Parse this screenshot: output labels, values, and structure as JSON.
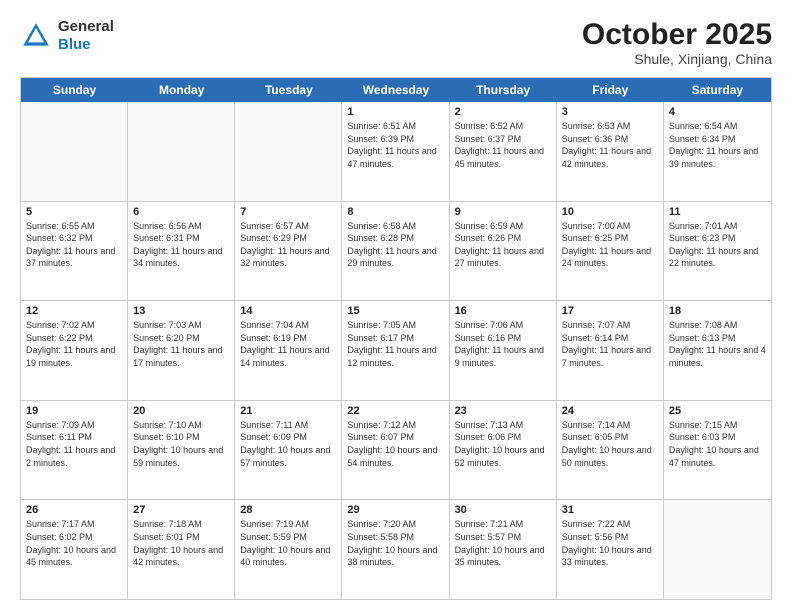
{
  "header": {
    "logo_general": "General",
    "logo_blue": "Blue",
    "title": "October 2025",
    "subtitle": "Shule, Xinjiang, China"
  },
  "weekdays": [
    "Sunday",
    "Monday",
    "Tuesday",
    "Wednesday",
    "Thursday",
    "Friday",
    "Saturday"
  ],
  "rows": [
    [
      {
        "day": "",
        "text": ""
      },
      {
        "day": "",
        "text": ""
      },
      {
        "day": "",
        "text": ""
      },
      {
        "day": "1",
        "text": "Sunrise: 6:51 AM\nSunset: 6:39 PM\nDaylight: 11 hours and 47 minutes."
      },
      {
        "day": "2",
        "text": "Sunrise: 6:52 AM\nSunset: 6:37 PM\nDaylight: 11 hours and 45 minutes."
      },
      {
        "day": "3",
        "text": "Sunrise: 6:53 AM\nSunset: 6:36 PM\nDaylight: 11 hours and 42 minutes."
      },
      {
        "day": "4",
        "text": "Sunrise: 6:54 AM\nSunset: 6:34 PM\nDaylight: 11 hours and 39 minutes."
      }
    ],
    [
      {
        "day": "5",
        "text": "Sunrise: 6:55 AM\nSunset: 6:32 PM\nDaylight: 11 hours and 37 minutes."
      },
      {
        "day": "6",
        "text": "Sunrise: 6:56 AM\nSunset: 6:31 PM\nDaylight: 11 hours and 34 minutes."
      },
      {
        "day": "7",
        "text": "Sunrise: 6:57 AM\nSunset: 6:29 PM\nDaylight: 11 hours and 32 minutes."
      },
      {
        "day": "8",
        "text": "Sunrise: 6:58 AM\nSunset: 6:28 PM\nDaylight: 11 hours and 29 minutes."
      },
      {
        "day": "9",
        "text": "Sunrise: 6:59 AM\nSunset: 6:26 PM\nDaylight: 11 hours and 27 minutes."
      },
      {
        "day": "10",
        "text": "Sunrise: 7:00 AM\nSunset: 6:25 PM\nDaylight: 11 hours and 24 minutes."
      },
      {
        "day": "11",
        "text": "Sunrise: 7:01 AM\nSunset: 6:23 PM\nDaylight: 11 hours and 22 minutes."
      }
    ],
    [
      {
        "day": "12",
        "text": "Sunrise: 7:02 AM\nSunset: 6:22 PM\nDaylight: 11 hours and 19 minutes."
      },
      {
        "day": "13",
        "text": "Sunrise: 7:03 AM\nSunset: 6:20 PM\nDaylight: 11 hours and 17 minutes."
      },
      {
        "day": "14",
        "text": "Sunrise: 7:04 AM\nSunset: 6:19 PM\nDaylight: 11 hours and 14 minutes."
      },
      {
        "day": "15",
        "text": "Sunrise: 7:05 AM\nSunset: 6:17 PM\nDaylight: 11 hours and 12 minutes."
      },
      {
        "day": "16",
        "text": "Sunrise: 7:06 AM\nSunset: 6:16 PM\nDaylight: 11 hours and 9 minutes."
      },
      {
        "day": "17",
        "text": "Sunrise: 7:07 AM\nSunset: 6:14 PM\nDaylight: 11 hours and 7 minutes."
      },
      {
        "day": "18",
        "text": "Sunrise: 7:08 AM\nSunset: 6:13 PM\nDaylight: 11 hours and 4 minutes."
      }
    ],
    [
      {
        "day": "19",
        "text": "Sunrise: 7:09 AM\nSunset: 6:11 PM\nDaylight: 11 hours and 2 minutes."
      },
      {
        "day": "20",
        "text": "Sunrise: 7:10 AM\nSunset: 6:10 PM\nDaylight: 10 hours and 59 minutes."
      },
      {
        "day": "21",
        "text": "Sunrise: 7:11 AM\nSunset: 6:09 PM\nDaylight: 10 hours and 57 minutes."
      },
      {
        "day": "22",
        "text": "Sunrise: 7:12 AM\nSunset: 6:07 PM\nDaylight: 10 hours and 54 minutes."
      },
      {
        "day": "23",
        "text": "Sunrise: 7:13 AM\nSunset: 6:06 PM\nDaylight: 10 hours and 52 minutes."
      },
      {
        "day": "24",
        "text": "Sunrise: 7:14 AM\nSunset: 6:05 PM\nDaylight: 10 hours and 50 minutes."
      },
      {
        "day": "25",
        "text": "Sunrise: 7:15 AM\nSunset: 6:03 PM\nDaylight: 10 hours and 47 minutes."
      }
    ],
    [
      {
        "day": "26",
        "text": "Sunrise: 7:17 AM\nSunset: 6:02 PM\nDaylight: 10 hours and 45 minutes."
      },
      {
        "day": "27",
        "text": "Sunrise: 7:18 AM\nSunset: 6:01 PM\nDaylight: 10 hours and 42 minutes."
      },
      {
        "day": "28",
        "text": "Sunrise: 7:19 AM\nSunset: 5:59 PM\nDaylight: 10 hours and 40 minutes."
      },
      {
        "day": "29",
        "text": "Sunrise: 7:20 AM\nSunset: 5:58 PM\nDaylight: 10 hours and 38 minutes."
      },
      {
        "day": "30",
        "text": "Sunrise: 7:21 AM\nSunset: 5:57 PM\nDaylight: 10 hours and 35 minutes."
      },
      {
        "day": "31",
        "text": "Sunrise: 7:22 AM\nSunset: 5:56 PM\nDaylight: 10 hours and 33 minutes."
      },
      {
        "day": "",
        "text": ""
      }
    ]
  ]
}
